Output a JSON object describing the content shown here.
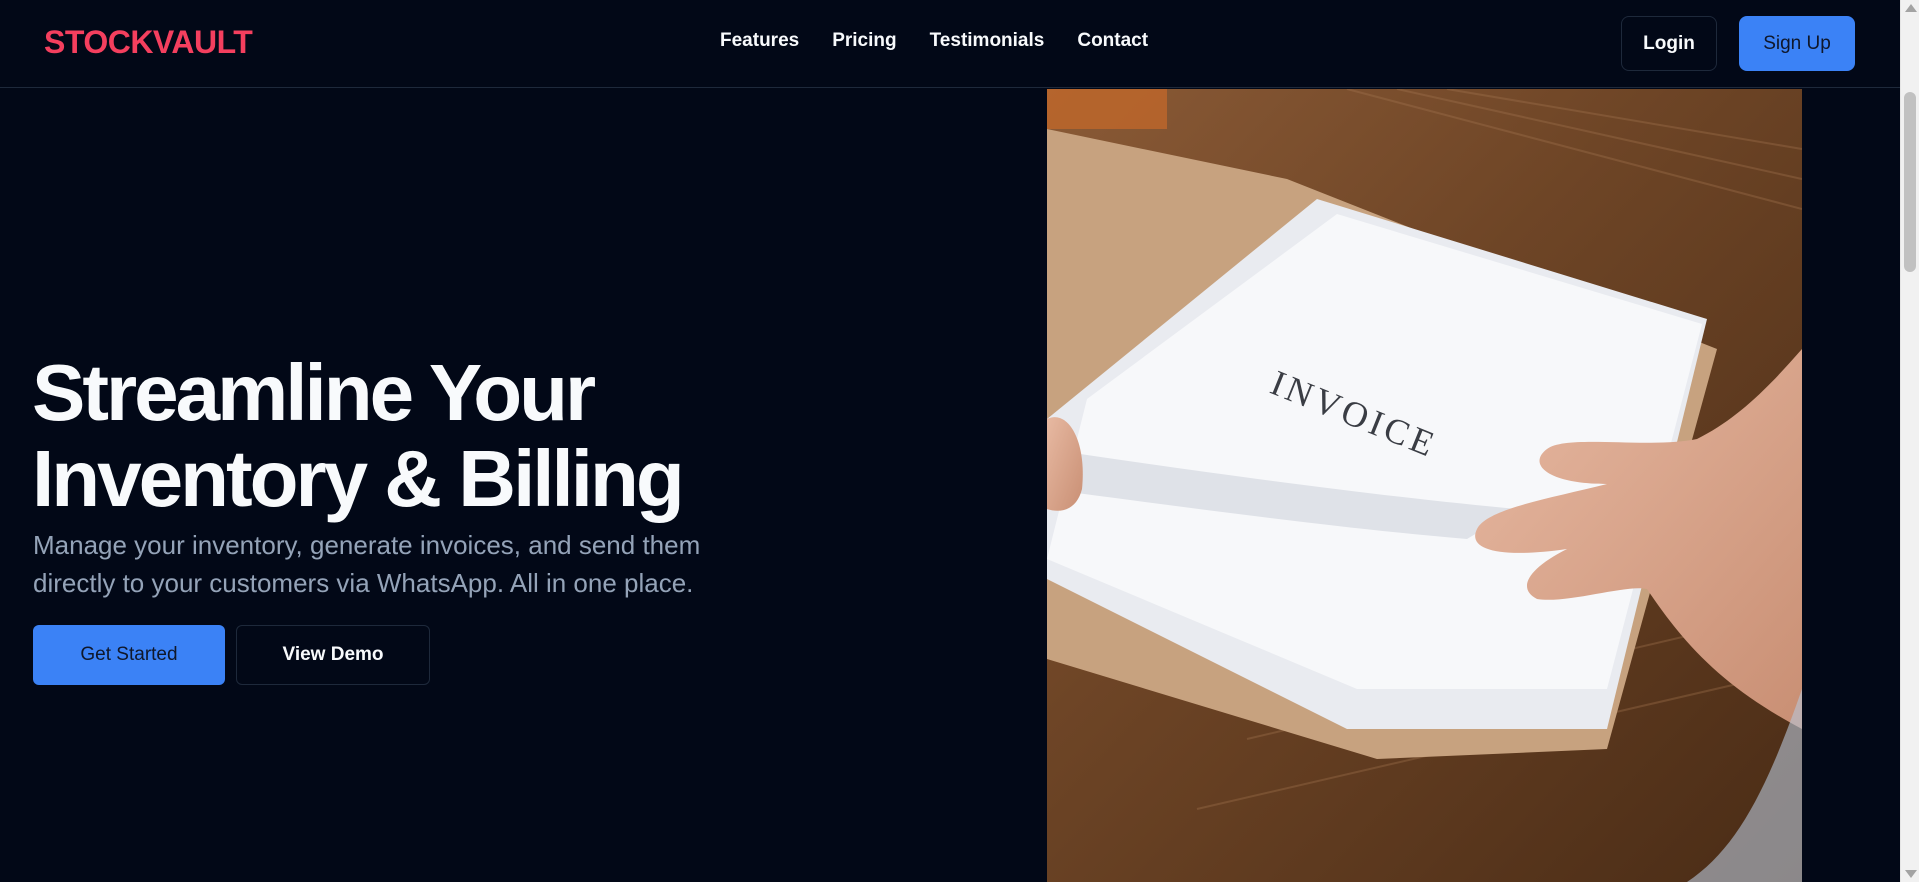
{
  "brand": {
    "logo_text": "STOCKVAULT",
    "accent_color": "#f43f5e",
    "primary_color": "#3b82f6"
  },
  "nav": {
    "items": [
      {
        "label": "Features"
      },
      {
        "label": "Pricing"
      },
      {
        "label": "Testimonials"
      },
      {
        "label": "Contact"
      }
    ]
  },
  "auth": {
    "login_label": "Login",
    "signup_label": "Sign Up"
  },
  "hero": {
    "title_line1": "Streamline Your",
    "title_line2": "Inventory & Billing",
    "subtitle_line1": "Manage your inventory, generate invoices, and send them",
    "subtitle_line2": "directly to your customers via WhatsApp. All in one place.",
    "cta_primary": "Get Started",
    "cta_secondary": "View Demo",
    "image_text": "INVOICE"
  }
}
